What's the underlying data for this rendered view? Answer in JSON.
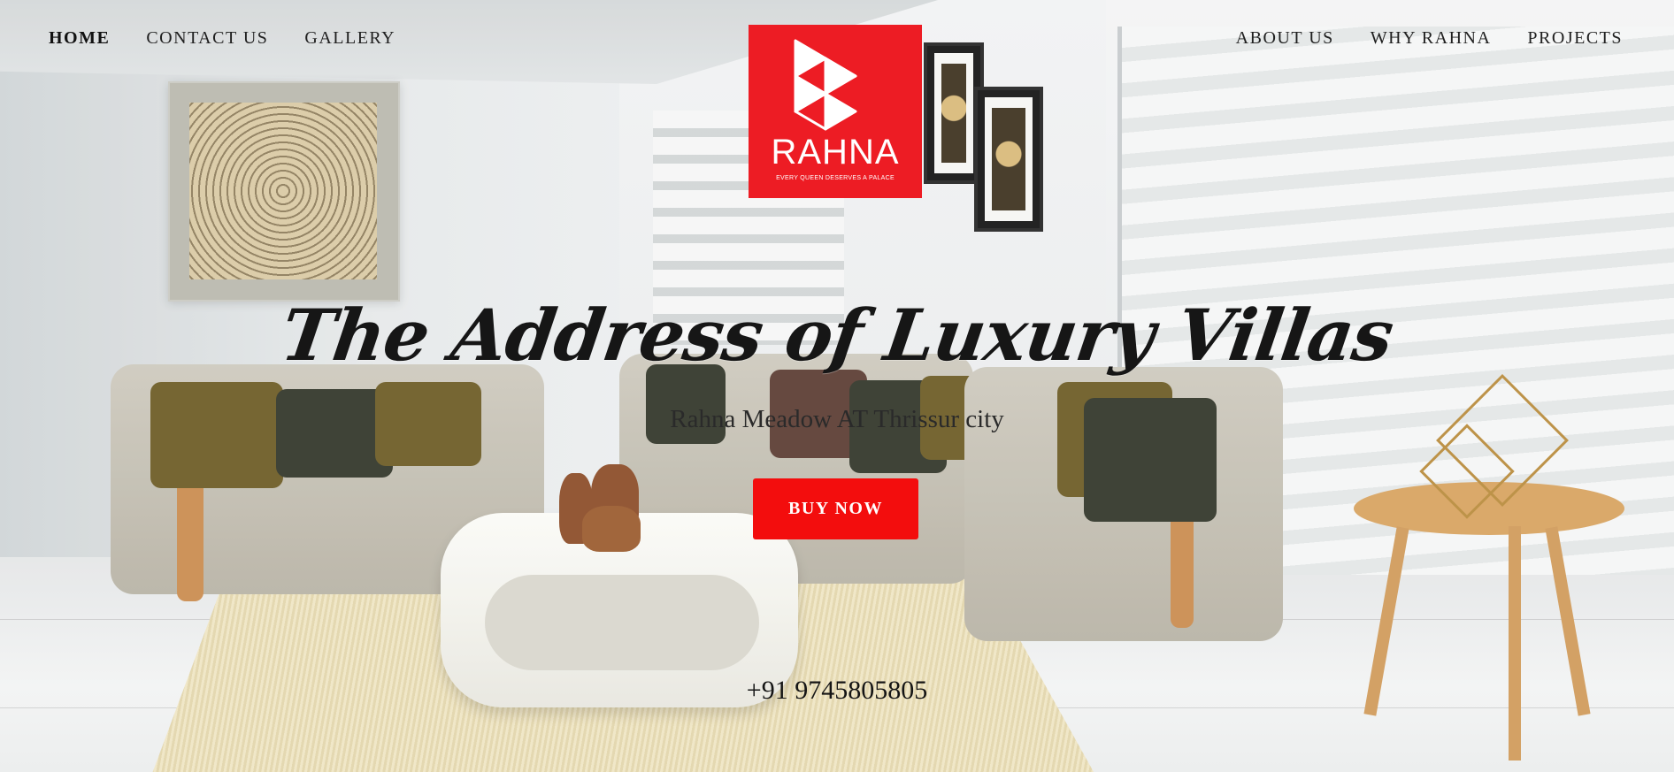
{
  "nav": {
    "left": [
      {
        "label": "HOME",
        "active": true
      },
      {
        "label": "CONTACT US",
        "active": false
      },
      {
        "label": "GALLERY",
        "active": false
      }
    ],
    "right": [
      {
        "label": "ABOUT US",
        "active": false
      },
      {
        "label": "WHY RAHNA",
        "active": false
      },
      {
        "label": "PROJECTS",
        "active": false
      }
    ]
  },
  "logo": {
    "name": "RAHNA",
    "tagline": "EVERY QUEEN DESERVES A PALACE",
    "background_color": "#ed1c24"
  },
  "hero": {
    "title": "The Address of Luxury Villas",
    "subtitle": "Rahna Meadow AT Thrissur city",
    "cta_label": "BUY NOW",
    "cta_color": "#f30d0d",
    "phone": "+91 9745805805"
  }
}
